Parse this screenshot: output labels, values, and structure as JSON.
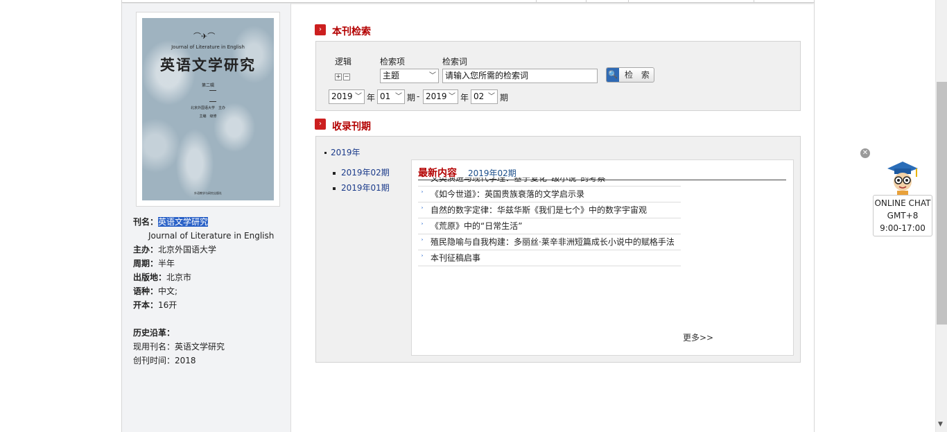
{
  "journal": {
    "cover": {
      "en_title": "Journal of Literature in English",
      "zh_title": "英语文学研究",
      "volume": "第二辑",
      "publisher": "北京外国语大学　主办",
      "editor": "主编　级修",
      "press": "外语教学与研究出版社"
    },
    "info": {
      "name_label": "刊名：",
      "name": "英语文学研究",
      "name_en": "Journal of Literature in English",
      "sponsor_label": "主办：",
      "sponsor": "北京外国语大学",
      "period_label": "周期：",
      "period": "半年",
      "place_label": "出版地：",
      "place": "北京市",
      "lang_label": "语种：",
      "lang": "中文;",
      "format_label": "开本：",
      "format": "16开"
    },
    "history": {
      "title": "历史沿革：",
      "current_label": "现用刊名：",
      "current": "英语文学研究",
      "founded_label": "创刊时间：",
      "founded": "2018"
    }
  },
  "search": {
    "title": "本刊检索",
    "logic_label": "逻辑",
    "field_label": "检索项",
    "term_label": "检索词",
    "field_value": "主题",
    "term_placeholder": "请输入您所需的检索词",
    "button_label": "检 索",
    "year_from": "2019",
    "year_label_1": "年",
    "issue_from": "01",
    "issue_label_1": "期",
    "dash": "-",
    "year_to": "2019",
    "year_label_2": "年",
    "issue_to": "02",
    "issue_label_2": "期"
  },
  "issues": {
    "title": "收录刊期",
    "year": "2019年",
    "items": [
      "2019年02期",
      "2019年01期"
    ]
  },
  "latest": {
    "title": "最新内容",
    "issue": "2019年02期",
    "articles": [
      "文类演进与现代学理：基于复化“级小说”的考察",
      "《如今世道》：英国贵族衰落的文学启示录",
      "自然的数字定律：华兹华斯《我们是七个》中的数字宇宙观",
      "《荒原》中的“日常生活”",
      "殖民隐喻与自我构建：多丽丝·莱辛非洲短篇成长小说中的赋格手法",
      "本刊征稿启事"
    ],
    "more": "更多>>"
  },
  "chat": {
    "line1": "ONLINE CHAT",
    "line2": "GMT+8",
    "line3": "9:00-17:00"
  }
}
